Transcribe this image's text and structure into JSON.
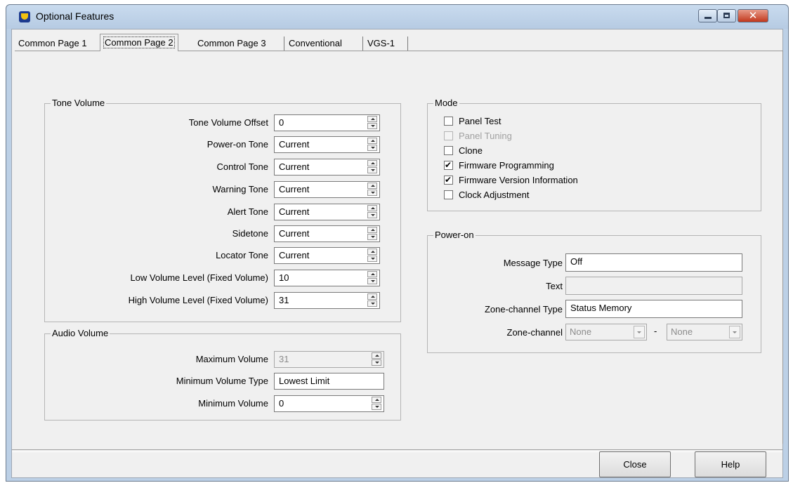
{
  "window": {
    "title": "Optional Features"
  },
  "tabs": [
    {
      "label": "Common Page 1",
      "active": false
    },
    {
      "label": "Common Page 2",
      "active": true
    },
    {
      "label": "Common Page 3",
      "active": false
    },
    {
      "label": "Conventional",
      "active": false
    },
    {
      "label": "VGS-1",
      "active": false
    }
  ],
  "tone_volume": {
    "legend": "Tone Volume",
    "rows": [
      {
        "label": "Tone Volume Offset",
        "value": "0"
      },
      {
        "label": "Power-on Tone",
        "value": "Current"
      },
      {
        "label": "Control Tone",
        "value": "Current"
      },
      {
        "label": "Warning Tone",
        "value": "Current"
      },
      {
        "label": "Alert Tone",
        "value": "Current"
      },
      {
        "label": "Sidetone",
        "value": "Current"
      },
      {
        "label": "Locator Tone",
        "value": "Current"
      },
      {
        "label": "Low Volume Level (Fixed Volume)",
        "value": "10"
      },
      {
        "label": "High Volume Level (Fixed Volume)",
        "value": "31"
      }
    ]
  },
  "audio_volume": {
    "legend": "Audio Volume",
    "maximum_volume": {
      "label": "Maximum Volume",
      "value": "31",
      "disabled": true
    },
    "minimum_volume_type": {
      "label": "Minimum Volume Type",
      "value": "Lowest Limit"
    },
    "minimum_volume": {
      "label": "Minimum Volume",
      "value": "0"
    }
  },
  "mode": {
    "legend": "Mode",
    "items": [
      {
        "label": "Panel Test",
        "checked": false,
        "disabled": false
      },
      {
        "label": "Panel Tuning",
        "checked": false,
        "disabled": true
      },
      {
        "label": "Clone",
        "checked": false,
        "disabled": false
      },
      {
        "label": "Firmware Programming",
        "checked": true,
        "disabled": false
      },
      {
        "label": "Firmware Version Information",
        "checked": true,
        "disabled": false
      },
      {
        "label": "Clock Adjustment",
        "checked": false,
        "disabled": false
      }
    ]
  },
  "power_on": {
    "legend": "Power-on",
    "message_type": {
      "label": "Message Type",
      "value": "Off"
    },
    "text": {
      "label": "Text",
      "value": ""
    },
    "zone_channel_type": {
      "label": "Zone-channel Type",
      "value": "Status Memory"
    },
    "zone_channel": {
      "label": "Zone-channel",
      "zone": "None",
      "separator": "-",
      "channel": "None"
    }
  },
  "buttons": {
    "close": "Close",
    "help": "Help"
  }
}
